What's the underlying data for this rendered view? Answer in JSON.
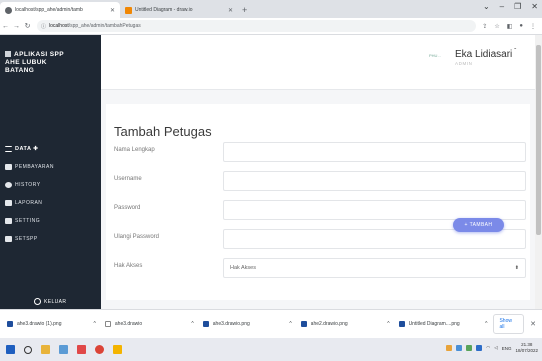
{
  "browser": {
    "tabs": [
      {
        "label": "localhost/spp_ahe/admin/tamb",
        "active": true
      },
      {
        "label": "Untitled Diagram - draw.io",
        "active": false
      }
    ],
    "url_host": "localhost",
    "url_path": "/spp_ahe/admin/tambahPetugas",
    "new_tab_label": "+"
  },
  "sidebar": {
    "brand_lines": [
      "APLIKASI SPP",
      "AHE LUBUK",
      "BATANG"
    ],
    "items": [
      {
        "label": "DATA ✚",
        "icon": "list-icon"
      },
      {
        "label": "PEMBAYARAN",
        "icon": "payment-icon"
      },
      {
        "label": "HISTORY",
        "icon": "history-icon"
      },
      {
        "label": "LAPORAN",
        "icon": "report-icon"
      },
      {
        "label": "SETTING",
        "icon": "users-gear-icon"
      },
      {
        "label": "SETSPP",
        "icon": "card-icon"
      }
    ],
    "logout_label": "KELUAR"
  },
  "header": {
    "avatar_alt": "PHU...",
    "user_name": "Eka Lidiasari",
    "user_role": "ADMIN"
  },
  "form": {
    "title": "Tambah Petugas",
    "fields": [
      {
        "label": "Nama Lengkap",
        "value": ""
      },
      {
        "label": "Username",
        "value": ""
      },
      {
        "label": "Password",
        "value": ""
      },
      {
        "label": "Ulangi Password",
        "value": ""
      },
      {
        "label": "Hak Akses",
        "value": "Hak Akses"
      }
    ],
    "submit_label": "+ TAMBAH"
  },
  "downloads": {
    "items": [
      "ahe3.drawio (1).png",
      "ahe3.drawio",
      "ahe3.drawio.png",
      "ahe2.drawio.png",
      "Untitled Diagram....png"
    ],
    "show_all_label": "Show all"
  },
  "taskbar": {
    "lang": "ENG",
    "time": "21.38",
    "date": "18/07/2022"
  },
  "colors": {
    "sidebar_bg": "#1e2733",
    "accent": "#7b8ae8"
  }
}
